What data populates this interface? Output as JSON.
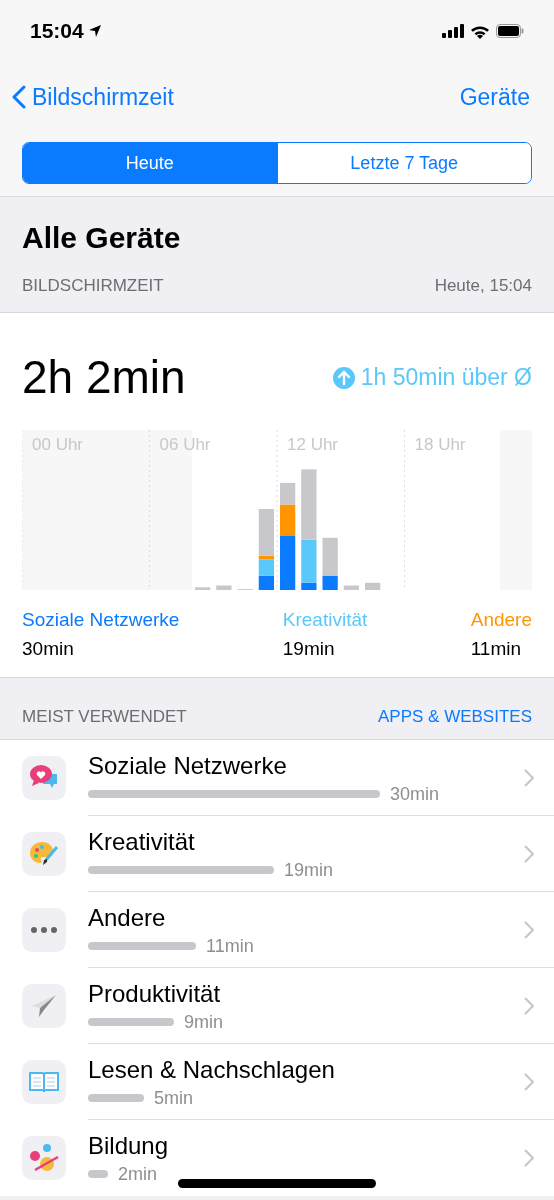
{
  "status_bar": {
    "time": "15:04"
  },
  "nav": {
    "back": "Bildschirmzeit",
    "action": "Geräte"
  },
  "segments": [
    {
      "label": "Heute",
      "selected": true
    },
    {
      "label": "Letzte 7 Tage",
      "selected": false
    }
  ],
  "title": "Alle Geräte",
  "section_header": {
    "label": "BILDSCHIRMZEIT",
    "date": "Heute, 15:04"
  },
  "summary": {
    "total": "2h 2min",
    "comparison": "1h 50min über Ø"
  },
  "chart_hours": [
    "00 Uhr",
    "06 Uhr",
    "12 Uhr",
    "18 Uhr"
  ],
  "legend": [
    {
      "label": "Soziale Netzwerke",
      "value": "30min",
      "color": "#0a7aff"
    },
    {
      "label": "Kreativität",
      "value": "19min",
      "color": "#5ac8fa"
    },
    {
      "label": "Andere",
      "value": "11min",
      "color": "#ff9500"
    }
  ],
  "most_used": {
    "label": "MEIST VERWENDET",
    "link": "APPS & WEBSITES"
  },
  "categories": [
    {
      "kind": "social",
      "name": "Soziale Netzwerke",
      "time": "30min"
    },
    {
      "kind": "creativity",
      "name": "Kreativität",
      "time": "19min"
    },
    {
      "kind": "other",
      "name": "Andere",
      "time": "11min"
    },
    {
      "kind": "productivity",
      "name": "Produktivität",
      "time": "9min"
    },
    {
      "kind": "reading",
      "name": "Lesen & Nachschlagen",
      "time": "5min"
    },
    {
      "kind": "education",
      "name": "Bildung",
      "time": "2min"
    }
  ]
}
